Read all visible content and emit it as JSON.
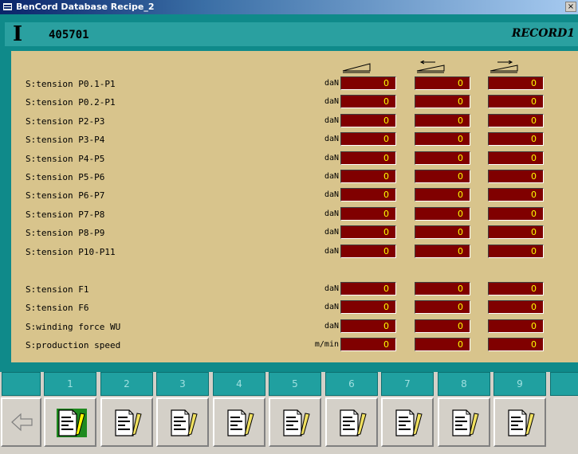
{
  "window": {
    "title": "BenCord Database Recipe_2",
    "close_symbol": "×"
  },
  "header": {
    "glyph": "I",
    "record_number": "405701",
    "record_label": "RECORD1"
  },
  "columns": {
    "icons": [
      "ramp-increase-icon",
      "ramp-back-icon",
      "ramp-forward-icon"
    ]
  },
  "rows": [
    {
      "label": "S:tension P0.1-P1",
      "unit": "daN",
      "values": [
        "0",
        "0",
        "0"
      ]
    },
    {
      "label": "S:tension P0.2-P1",
      "unit": "daN",
      "values": [
        "0",
        "0",
        "0"
      ]
    },
    {
      "label": "S:tension P2-P3",
      "unit": "daN",
      "values": [
        "0",
        "0",
        "0"
      ]
    },
    {
      "label": "S:tension P3-P4",
      "unit": "daN",
      "values": [
        "0",
        "0",
        "0"
      ]
    },
    {
      "label": "S:tension P4-P5",
      "unit": "daN",
      "values": [
        "0",
        "0",
        "0"
      ]
    },
    {
      "label": "S:tension P5-P6",
      "unit": "daN",
      "values": [
        "0",
        "0",
        "0"
      ]
    },
    {
      "label": "S:tension P6-P7",
      "unit": "daN",
      "values": [
        "0",
        "0",
        "0"
      ]
    },
    {
      "label": "S:tension P7-P8",
      "unit": "daN",
      "values": [
        "0",
        "0",
        "0"
      ]
    },
    {
      "label": "S:tension P8-P9",
      "unit": "daN",
      "values": [
        "0",
        "0",
        "0"
      ]
    },
    {
      "label": "S:tension P10-P11",
      "unit": "daN",
      "values": [
        "0",
        "0",
        "0"
      ]
    },
    {
      "label": "S:tension F1",
      "unit": "daN",
      "values": [
        "0",
        "0",
        "0"
      ]
    },
    {
      "label": "S:tension F6",
      "unit": "daN",
      "values": [
        "0",
        "0",
        "0"
      ]
    },
    {
      "label": "S:winding force WU",
      "unit": "daN",
      "values": [
        "0",
        "0",
        "0"
      ]
    },
    {
      "label": "S:production speed",
      "unit": "m/min",
      "values": [
        "0",
        "0",
        "0"
      ]
    }
  ],
  "nav": {
    "numbers": [
      "1",
      "2",
      "3",
      "4",
      "5",
      "6",
      "7",
      "8",
      "9"
    ],
    "active_index": 0,
    "back_icon": "back-arrow-icon",
    "button_icon": "document-edit-icon"
  },
  "colors": {
    "teal": "#0f8a8a",
    "panel": "#d8c48c",
    "value_bg": "#800000",
    "value_text": "#ffff00",
    "active_green": "#1f8a1f"
  }
}
